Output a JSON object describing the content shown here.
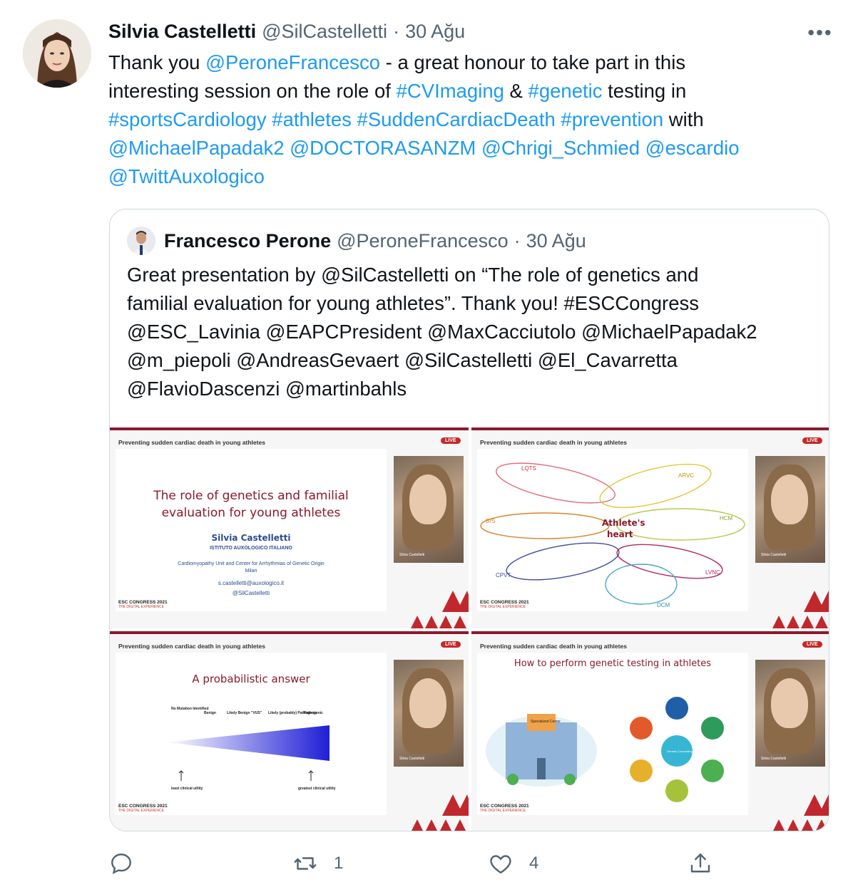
{
  "tweet": {
    "author_name": "Silvia Castelletti",
    "handle": "@SilCastelletti",
    "separator": "·",
    "date": "30 Ağu",
    "more_label": "•••",
    "text": {
      "l1_a": "Thank you ",
      "l1_mention": "@PeroneFrancesco",
      "l1_b": " - a great honour to take part in this",
      "l2_a": "interesting session on the role of ",
      "l2_tag1": "#CVImaging",
      "l2_b": " & ",
      "l2_tag2": "#genetic",
      "l2_c": " testing in",
      "l3_tags": "#sportsCardiology #athletes #SuddenCardiacDeath #prevention",
      "l3_b": " with",
      "l4_mentions": "@MichaelPapadak2 @DOCTORASANZM @Chrigi_Schmied @escardio",
      "l5_mentions": "@TwittAuxologico"
    }
  },
  "quote": {
    "author_name": "Francesco Perone",
    "handle": "@PeroneFrancesco",
    "separator": "·",
    "date": "30 Ağu",
    "lines": [
      "Great presentation by @SilCastelletti on “The role of genetics and",
      "familial evaluation for young athletes”. Thank you! #ESCCongress",
      "@ESC_Lavinia @EAPCPresident @MaxCacciutolo @MichaelPapadak2",
      "@m_piepoli @AndreasGevaert @SilCastelletti @El_Cavarretta",
      "@FlavioDascenzi @martinbahls"
    ],
    "slides": {
      "header": "Preventing sudden cardiac death in young athletes",
      "live": "LIVE",
      "esc": "ESC CONGRESS 2021",
      "esc_sub": "THE DIGITAL EXPERIENCE",
      "video_caption": "Silvia Castelletti",
      "s1": {
        "title_1": "The role of genetics and familial",
        "title_2": "evaluation for young athletes",
        "speaker": "Silvia Castelletti",
        "institute": "ISTITUTO AUXOLOGICO ITALIANO",
        "unit": "Cardiomyopathy Unit and Center for Arrhythmias of Genetic Origin",
        "city": "Milan",
        "email": "s.castelletti@auxologico.it",
        "twitter": "@SilCastelletti"
      },
      "s2": {
        "center_1": "Athlete's",
        "center_2": "heart",
        "labels": [
          "LQTS",
          "ARVC",
          "BrS",
          "HCM",
          "CPVT",
          "LVNC",
          "DCM"
        ]
      },
      "s3": {
        "title": "A probabilistic answer",
        "scale": [
          "No Mutation Identified",
          "Benign",
          "Likely Benign",
          "\"VUS\"",
          "Likely (probably) Pathogenic",
          "Pathogenic"
        ],
        "left_note": "least clinical utility",
        "right_note": "greatest clinical utility"
      },
      "s4": {
        "title": "How to perform genetic testing in athletes",
        "center_label": "Specialized Center",
        "hub": "Genetic Counselling"
      }
    }
  },
  "actions": {
    "reply_count": "",
    "retweet_count": "1",
    "like_count": "4"
  },
  "colors": {
    "link": "#1d9bf0",
    "muted": "#536471",
    "text": "#0f1419",
    "border": "#cfd9de",
    "slide_accent": "#8b1a2b"
  }
}
